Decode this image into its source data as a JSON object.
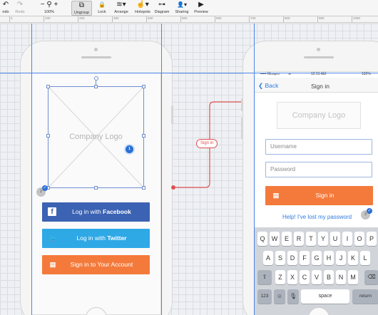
{
  "toolbar": {
    "items": [
      {
        "label": "ndo",
        "icon": "undo-icon",
        "glyph": "↶"
      },
      {
        "label": "Redo",
        "icon": "redo-icon",
        "glyph": "↷"
      },
      {
        "label": "100%",
        "icon": "zoom-icon",
        "glyph": "− ⚲ +"
      },
      {
        "label": "Ungroup",
        "icon": "ungroup-icon",
        "glyph": "⧉"
      },
      {
        "label": "Lock",
        "icon": "lock-icon",
        "glyph": "🔒"
      },
      {
        "label": "Arrange",
        "icon": "arrange-icon",
        "glyph": "≋▾"
      },
      {
        "label": "Hotspots",
        "icon": "hotspot-icon",
        "glyph": "☝▾"
      },
      {
        "label": "Diagram",
        "icon": "diagram-icon",
        "glyph": "⊶"
      },
      {
        "label": "Sharing",
        "icon": "sharing-icon",
        "glyph": "👤▾"
      },
      {
        "label": "Preview",
        "icon": "preview-icon",
        "glyph": "▶"
      }
    ]
  },
  "ruler": {
    "ticks": [
      "0",
      "100",
      "200",
      "300",
      "400",
      "500",
      "600",
      "700",
      "800",
      "900",
      "1000"
    ]
  },
  "phone_left": {
    "logo_text": "Company Logo",
    "badge_1": "1",
    "badge_2": "2",
    "buttons": {
      "facebook": {
        "prefix": "Log in with ",
        "bold": "Facebook",
        "glyph": "f"
      },
      "twitter": {
        "prefix": "Log in with ",
        "bold": "Twitter",
        "glyph": "🐦"
      },
      "account": {
        "text": "Sign in to Your Account",
        "glyph": "▤"
      }
    }
  },
  "connector": {
    "label": "Sign in",
    "color": "#e05050"
  },
  "phone_right": {
    "status": {
      "carrier": "••••• Mospro",
      "wifi": "wifi-icon",
      "time": "12:51 AM",
      "battery": "100%"
    },
    "nav": {
      "back": "Back",
      "title": "Sign in"
    },
    "logo_text": "Company Logo",
    "username_placeholder": "Username",
    "password_placeholder": "Password",
    "signin_label": "Sign in",
    "lost_password": "Help! I've lost my password",
    "badge_3": "3",
    "keyboard": {
      "row1": [
        "Q",
        "W",
        "E",
        "R",
        "T",
        "Y",
        "U",
        "I",
        "O",
        "P"
      ],
      "row2": [
        "A",
        "S",
        "D",
        "F",
        "G",
        "H",
        "J",
        "K",
        "L"
      ],
      "row3": [
        "Z",
        "X",
        "C",
        "V",
        "B",
        "N",
        "M"
      ],
      "num_key": "123",
      "space_key": "space",
      "return_key": "return"
    }
  },
  "colors": {
    "facebook": "#3b62b3",
    "twitter": "#2fa8e6",
    "accent": "#f47a3b",
    "guide": "#4a86e8",
    "link": "#2f7be0"
  }
}
